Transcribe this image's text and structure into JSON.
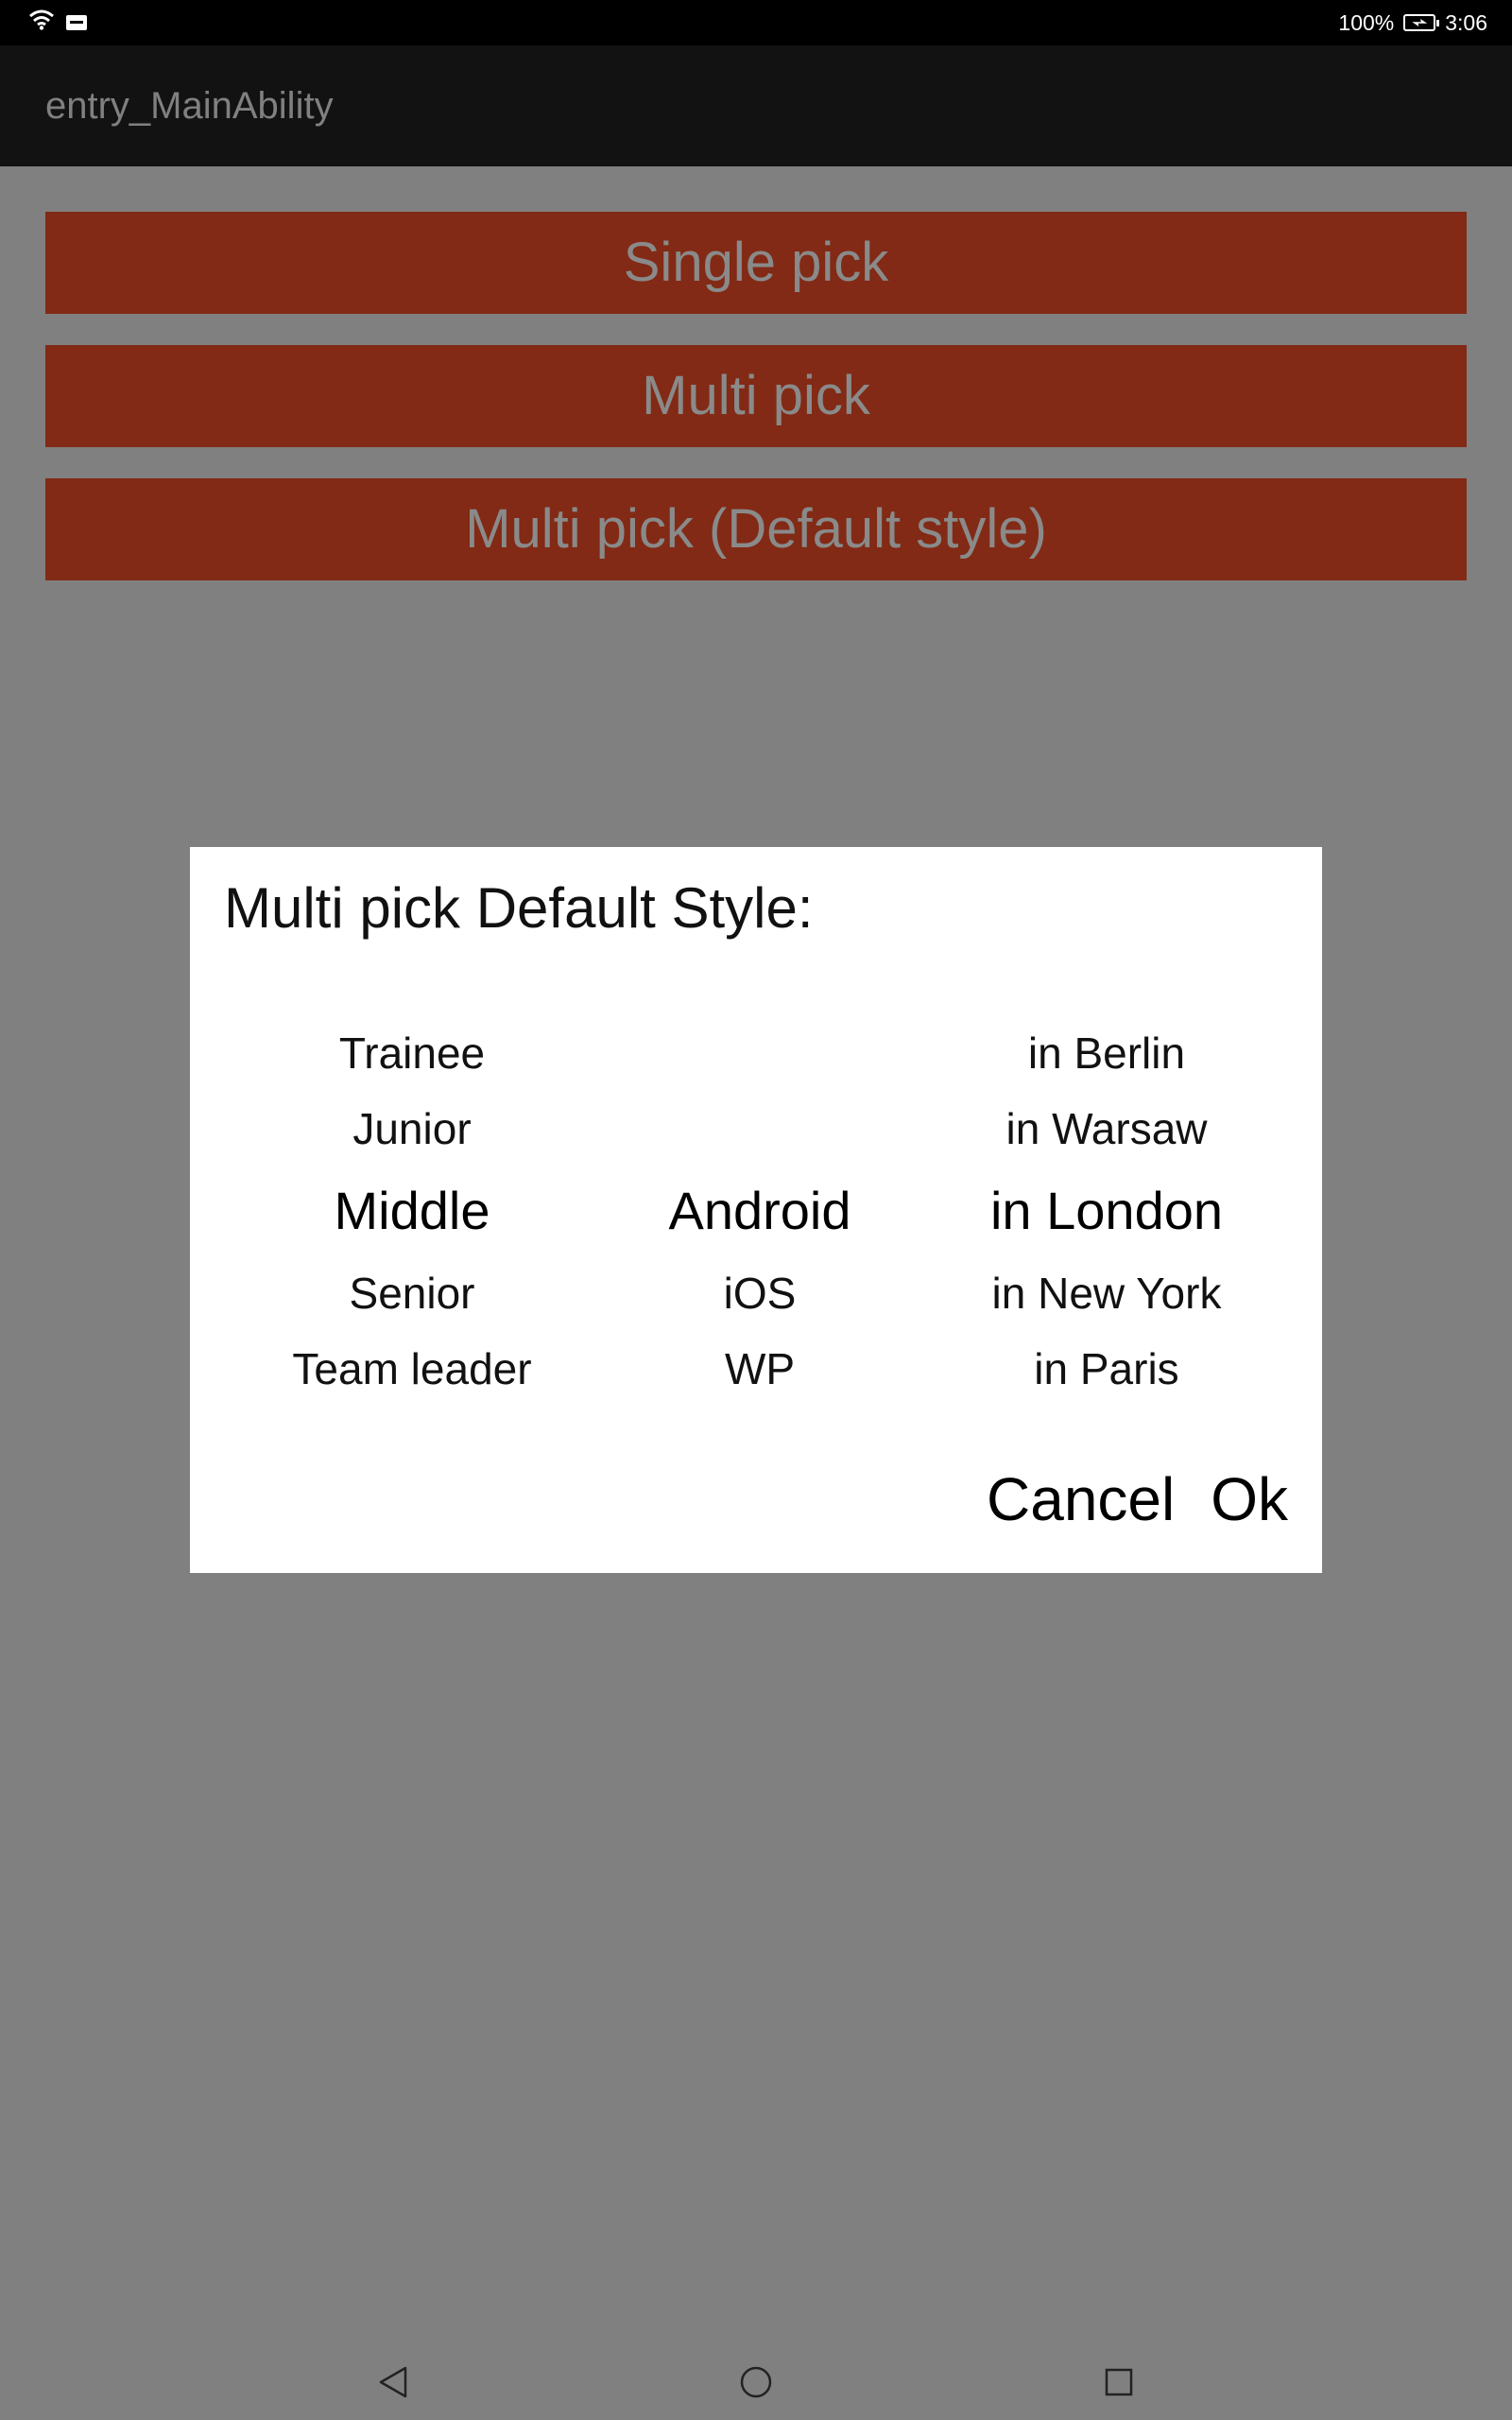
{
  "status_bar": {
    "battery": "100%",
    "time": "3:06",
    "icons": [
      "wifi-icon",
      "sim-icon",
      "battery-charging-icon"
    ]
  },
  "app_bar": {
    "title": "entry_MainAbility"
  },
  "buttons": {
    "single_pick": "Single pick",
    "multi_pick": "Multi pick",
    "multi_pick_default": "Multi pick (Default style)"
  },
  "colors": {
    "accent_button": "#822a15",
    "scrim": "#808080",
    "app_bar": "#121212"
  },
  "dialog": {
    "title": "Multi pick Default Style:",
    "columns": [
      {
        "items": [
          "Trainee",
          "Junior",
          "Middle",
          "Senior",
          "Team leader"
        ],
        "selected": "Middle"
      },
      {
        "items": [
          "",
          "",
          "Android",
          "iOS",
          "WP"
        ],
        "selected": "Android"
      },
      {
        "items": [
          "in Berlin",
          "in Warsaw",
          "in London",
          "in New York",
          "in Paris"
        ],
        "selected": "in London"
      }
    ],
    "cancel": "Cancel",
    "ok": "Ok"
  },
  "nav_bar": {
    "icons": [
      "back-icon",
      "home-icon",
      "recents-icon"
    ]
  }
}
